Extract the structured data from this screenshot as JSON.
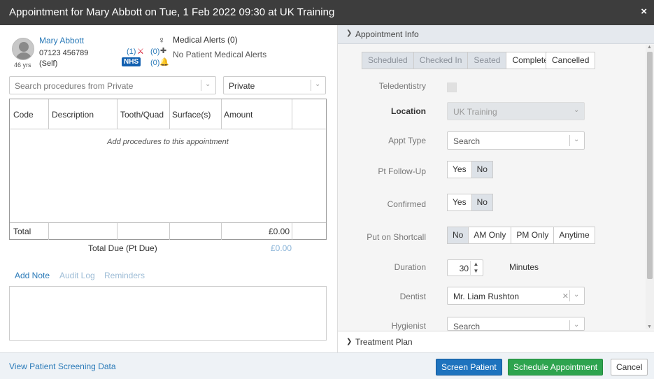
{
  "window": {
    "title": "Appointment for Mary Abbott on Tue, 1 Feb 2022 09:30 at UK Training",
    "close_icon": "×"
  },
  "patient": {
    "name": "Mary Abbott",
    "phone": "07123 456789",
    "relation": "(Self)",
    "age": "46 yrs",
    "lab_count": "(1)",
    "plus_count": "(0)",
    "bell_count": "(0)",
    "nhs_badge": "NHS",
    "medical_alerts": "Medical Alerts (0)",
    "no_alerts": "No Patient Medical Alerts"
  },
  "procedures": {
    "search_placeholder": "Search procedures from Private",
    "price_list": "Private",
    "columns": [
      "Code",
      "Description",
      "Tooth/Quad",
      "Surface(s)",
      "Amount"
    ],
    "empty_message": "Add procedures to this appointment",
    "total_label": "Total",
    "total_amount": "£0.00",
    "total_due_label": "Total Due (Pt Due)",
    "total_due_amount": "£0.00"
  },
  "note_tabs": {
    "add_note": "Add Note",
    "audit_log": "Audit Log",
    "reminders": "Reminders"
  },
  "appt_info": {
    "header": "Appointment Info",
    "statuses": [
      "Scheduled",
      "Checked In",
      "Seated",
      "Completed"
    ],
    "cancelled": "Cancelled",
    "teledentistry_label": "Teledentistry",
    "location_label": "Location",
    "location_value": "UK Training",
    "appt_type_label": "Appt Type",
    "appt_type_placeholder": "Search",
    "followup_label": "Pt Follow-Up",
    "confirmed_label": "Confirmed",
    "yes": "Yes",
    "no": "No",
    "shortcall_label": "Put on Shortcall",
    "shortcall_options": [
      "No",
      "AM Only",
      "PM Only",
      "Anytime"
    ],
    "duration_label": "Duration",
    "duration_value": "30",
    "minutes_label": "Minutes",
    "dentist_label": "Dentist",
    "dentist_value": "Mr. Liam Rushton",
    "hygienist_label": "Hygienist",
    "hygienist_placeholder": "Search"
  },
  "treatment_plan": {
    "header": "Treatment Plan"
  },
  "footer": {
    "screening_link": "View Patient Screening Data",
    "screen_patient": "Screen Patient",
    "schedule": "Schedule Appointment",
    "cancel": "Cancel"
  },
  "colors": {
    "title_bg": "#3d3d3d",
    "link": "#2a7ab8",
    "primary_btn": "#1e73be",
    "success_btn": "#2ea44f",
    "nhs": "#1260b0"
  }
}
